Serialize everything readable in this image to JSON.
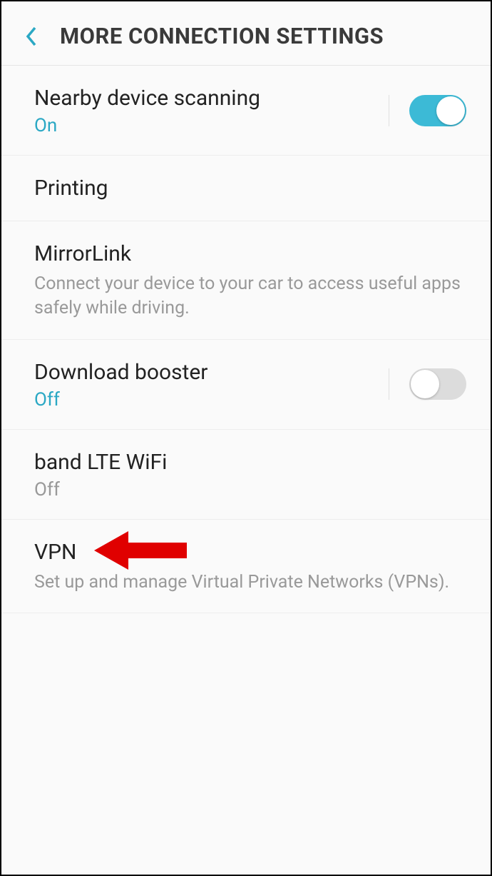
{
  "header": {
    "title": "MORE CONNECTION SETTINGS"
  },
  "settings": {
    "nearby": {
      "title": "Nearby device scanning",
      "status": "On",
      "toggle": true
    },
    "printing": {
      "title": "Printing"
    },
    "mirrorlink": {
      "title": "MirrorLink",
      "subtitle": "Connect your device to your car to access useful apps safely while driving."
    },
    "download_booster": {
      "title": "Download booster",
      "status": "Off",
      "toggle": false
    },
    "band_lte": {
      "title": "band LTE WiFi",
      "status": "Off"
    },
    "vpn": {
      "title": "VPN",
      "subtitle": "Set up and manage Virtual Private Networks (VPNs)."
    }
  }
}
